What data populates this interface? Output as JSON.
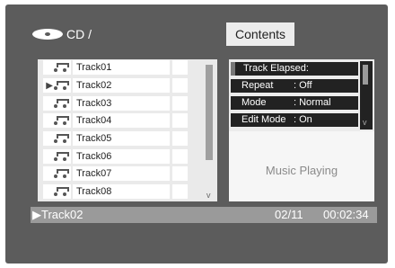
{
  "header": {
    "path": "CD /",
    "disc_icon": "cd-disc-icon"
  },
  "tab": {
    "label": "Contents"
  },
  "tracks": [
    {
      "name": "Track01",
      "playing": false,
      "icon": "music-note-icon"
    },
    {
      "name": "Track02",
      "playing": true,
      "icon": "music-note-icon"
    },
    {
      "name": "Track03",
      "playing": false,
      "icon": "music-note-icon"
    },
    {
      "name": "Track04",
      "playing": false,
      "icon": "music-note-icon"
    },
    {
      "name": "Track05",
      "playing": false,
      "icon": "music-note-icon"
    },
    {
      "name": "Track06",
      "playing": false,
      "icon": "music-note-icon"
    },
    {
      "name": "Track07",
      "playing": false,
      "icon": "music-note-icon"
    },
    {
      "name": "Track08",
      "playing": false,
      "icon": "music-note-icon"
    }
  ],
  "play_marker": "▶",
  "list_scroll": {
    "arrow": "v"
  },
  "info": {
    "rows": [
      {
        "label": "Track Elapsed:",
        "value": ""
      },
      {
        "label": "Repeat",
        "value": ": Off"
      },
      {
        "label": "Mode",
        "value": ": Normal"
      },
      {
        "label": "Edit Mode",
        "value": ": On"
      }
    ],
    "scroll_arrow": "v",
    "status_message": "Music Playing"
  },
  "status_bar": {
    "current_track": "▶Track02",
    "track_count": "02/11",
    "elapsed_time": "00:02:34"
  },
  "colors": {
    "screen_bg": "#5c5c5c",
    "panel_bg": "#eaeaea",
    "info_row_bg": "#222222",
    "status_bar_bg": "#9a9a9a"
  }
}
